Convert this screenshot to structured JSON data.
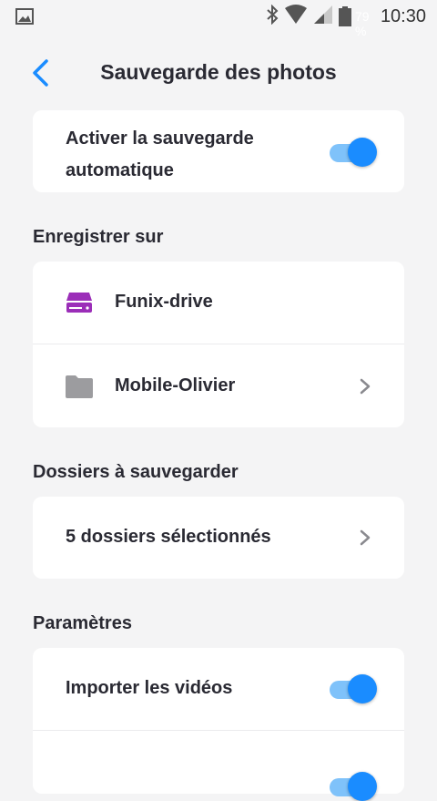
{
  "status_bar": {
    "battery_percent": "79 %",
    "time": "10:30"
  },
  "header": {
    "title": "Sauvegarde des photos"
  },
  "auto_backup": {
    "label_line1": "Activer la sauvegarde",
    "label_line2": "automatique",
    "enabled": true
  },
  "save_to": {
    "section_title": "Enregistrer sur",
    "items": [
      {
        "label": "Funix-drive",
        "icon": "drive-icon",
        "icon_color": "#9B2EB8"
      },
      {
        "label": "Mobile-Olivier",
        "icon": "folder-icon",
        "icon_color": "#9C9C9F"
      }
    ]
  },
  "folders": {
    "section_title": "Dossiers à sauvegarder",
    "selected_label": "5 dossiers sélectionnés"
  },
  "settings": {
    "section_title": "Paramètres",
    "items": [
      {
        "label": "Importer les vidéos",
        "enabled": true
      },
      {
        "label": "",
        "enabled": true
      }
    ]
  },
  "colors": {
    "accent": "#1A8CFF",
    "toggle_track": "#7FC2FA",
    "background": "#F4F4F5",
    "text": "#2A2A33"
  }
}
